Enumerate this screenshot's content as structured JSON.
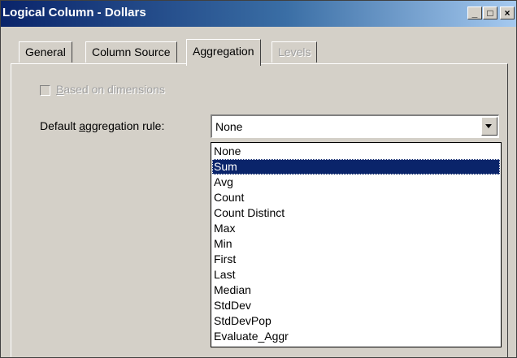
{
  "window": {
    "title": "Logical Column - Dollars"
  },
  "title_buttons": {
    "minimize": "_",
    "maximize": "□",
    "close": "×"
  },
  "tabs": [
    {
      "label": "General",
      "state": "normal"
    },
    {
      "label": "Column Source",
      "state": "normal"
    },
    {
      "label": "Aggregation",
      "state": "active"
    },
    {
      "label": "Levels",
      "state": "disabled"
    }
  ],
  "aggregation": {
    "based_on_dimensions": {
      "label": "Based on dimensions",
      "mnemonic": "B",
      "checked": false,
      "enabled": false
    },
    "default_rule_label": "Default aggregation rule:",
    "default_rule_value": "None",
    "options": [
      "None",
      "Sum",
      "Avg",
      "Count",
      "Count Distinct",
      "Max",
      "Min",
      "First",
      "Last",
      "Median",
      "StdDev",
      "StdDevPop",
      "Evaluate_Aggr"
    ],
    "highlighted_option": "Sum"
  },
  "colors": {
    "title_active": "#0a246a",
    "face": "#d4d0c8",
    "highlight": "#0a246a"
  }
}
